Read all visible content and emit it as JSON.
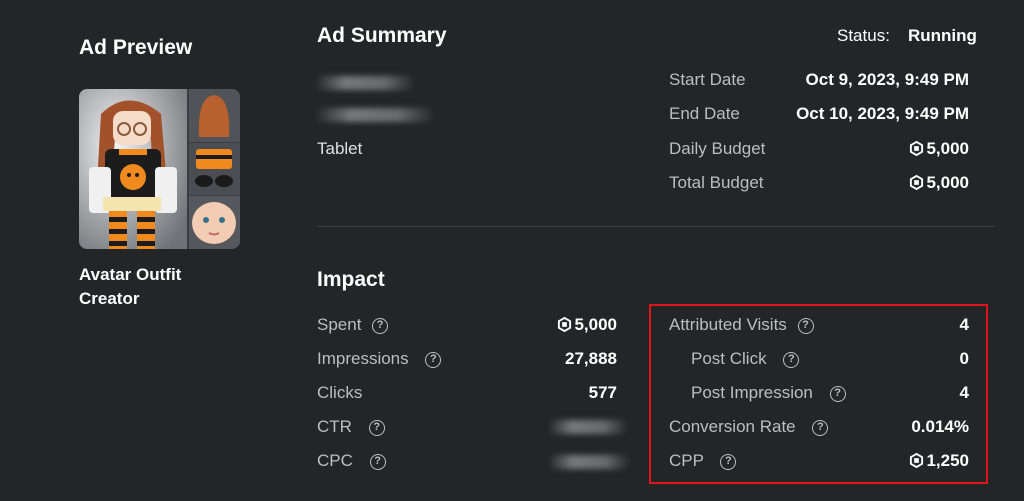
{
  "preview": {
    "title": "Ad Preview",
    "ad_name": "Avatar Outfit Creator"
  },
  "summary": {
    "title": "Ad Summary",
    "status_label": "Status:",
    "status_value": "Running",
    "platform": "Tablet",
    "details": [
      {
        "label": "Start Date",
        "value": "Oct 9, 2023, 9:49 PM",
        "robux": false
      },
      {
        "label": "End Date",
        "value": "Oct 10, 2023, 9:49 PM",
        "robux": false
      },
      {
        "label": "Daily Budget",
        "value": "5,000",
        "robux": true
      },
      {
        "label": "Total Budget",
        "value": "5,000",
        "robux": true
      }
    ]
  },
  "impact": {
    "title": "Impact",
    "left": [
      {
        "label": "Spent",
        "value": "5,000",
        "robux": true
      },
      {
        "label": "Impressions",
        "value": "27,888",
        "robux": false
      },
      {
        "label": "Clicks",
        "value": "577",
        "robux": false
      },
      {
        "label": "CTR",
        "value": "",
        "robux": false
      },
      {
        "label": "CPC",
        "value": "",
        "robux": false
      }
    ],
    "right": [
      {
        "label": "Attributed Visits",
        "value": "4",
        "robux": false
      },
      {
        "label": "Post Click",
        "value": "0",
        "robux": false
      },
      {
        "label": "Post Impression",
        "value": "4",
        "robux": false
      },
      {
        "label": "Conversion Rate",
        "value": "0.014%",
        "robux": false
      },
      {
        "label": "CPP",
        "value": "1,250",
        "robux": true
      }
    ],
    "help_glyph": "?"
  },
  "colors": {
    "background": "#232527",
    "highlight_box": "#e0141a"
  }
}
